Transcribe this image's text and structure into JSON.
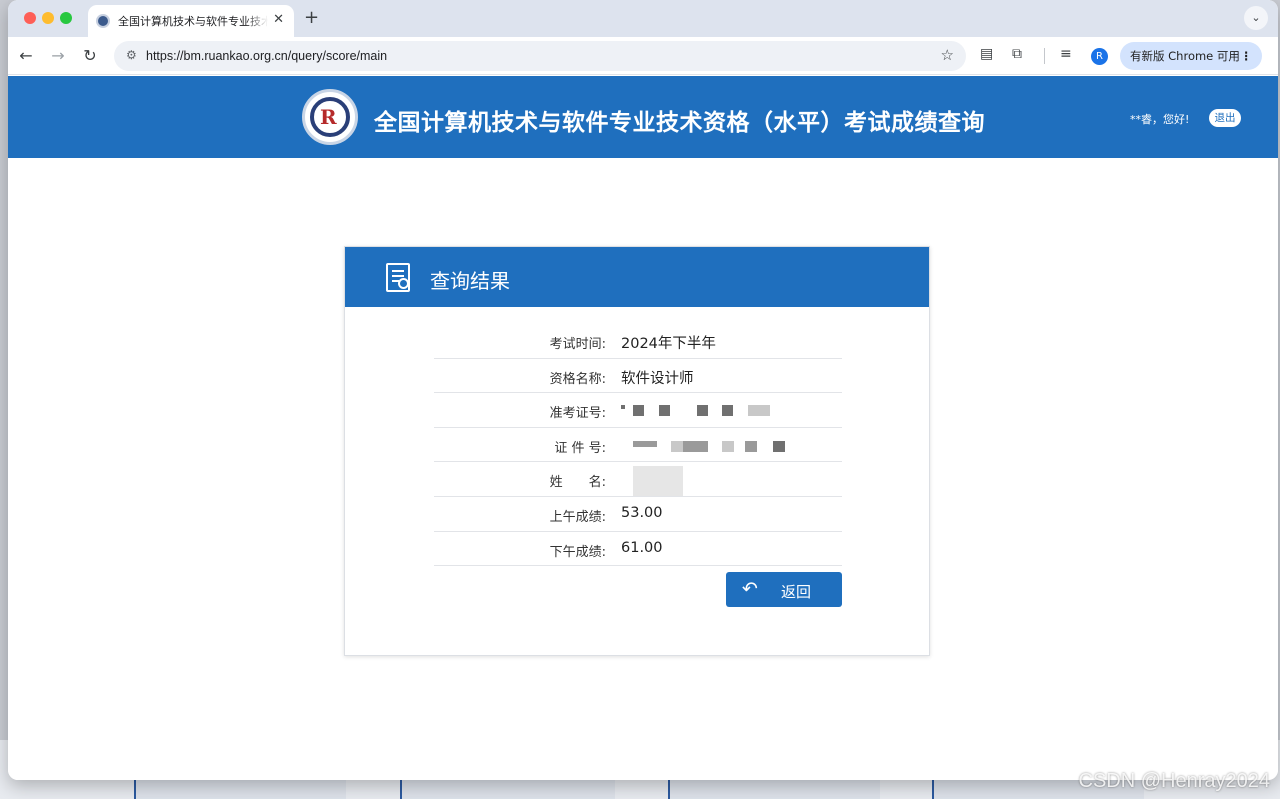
{
  "browser": {
    "tab_title": "全国计算机技术与软件专业技术资格（水平）考试成绩查询",
    "tab_close": "✕",
    "new_tab": "+",
    "url": "https://bm.ruankao.org.cn/query/score/main",
    "profile_initial": "R",
    "update_label": "有新版 Chrome 可用"
  },
  "header": {
    "title": "全国计算机技术与软件专业技术资格（水平）考试成绩查询",
    "greeting": "**睿，您好!",
    "logout_label": "退出"
  },
  "result": {
    "title": "查询结果",
    "rows": [
      {
        "label": "考试时间:",
        "value": "2024年下半年"
      },
      {
        "label": "资格名称:",
        "value": "软件设计师"
      },
      {
        "label": "准考证号:",
        "value": ""
      },
      {
        "label": "证 件 号:",
        "value": ""
      },
      {
        "label": "姓　　名:",
        "value": ""
      },
      {
        "label": "上午成绩:",
        "value": "53.00"
      },
      {
        "label": "下午成绩:",
        "value": "61.00"
      }
    ],
    "back_label": "返回"
  },
  "watermark": "CSDN @Henray2024",
  "colors": {
    "header_blue": "#1f6fbe",
    "page_bg": "#ffffff"
  }
}
